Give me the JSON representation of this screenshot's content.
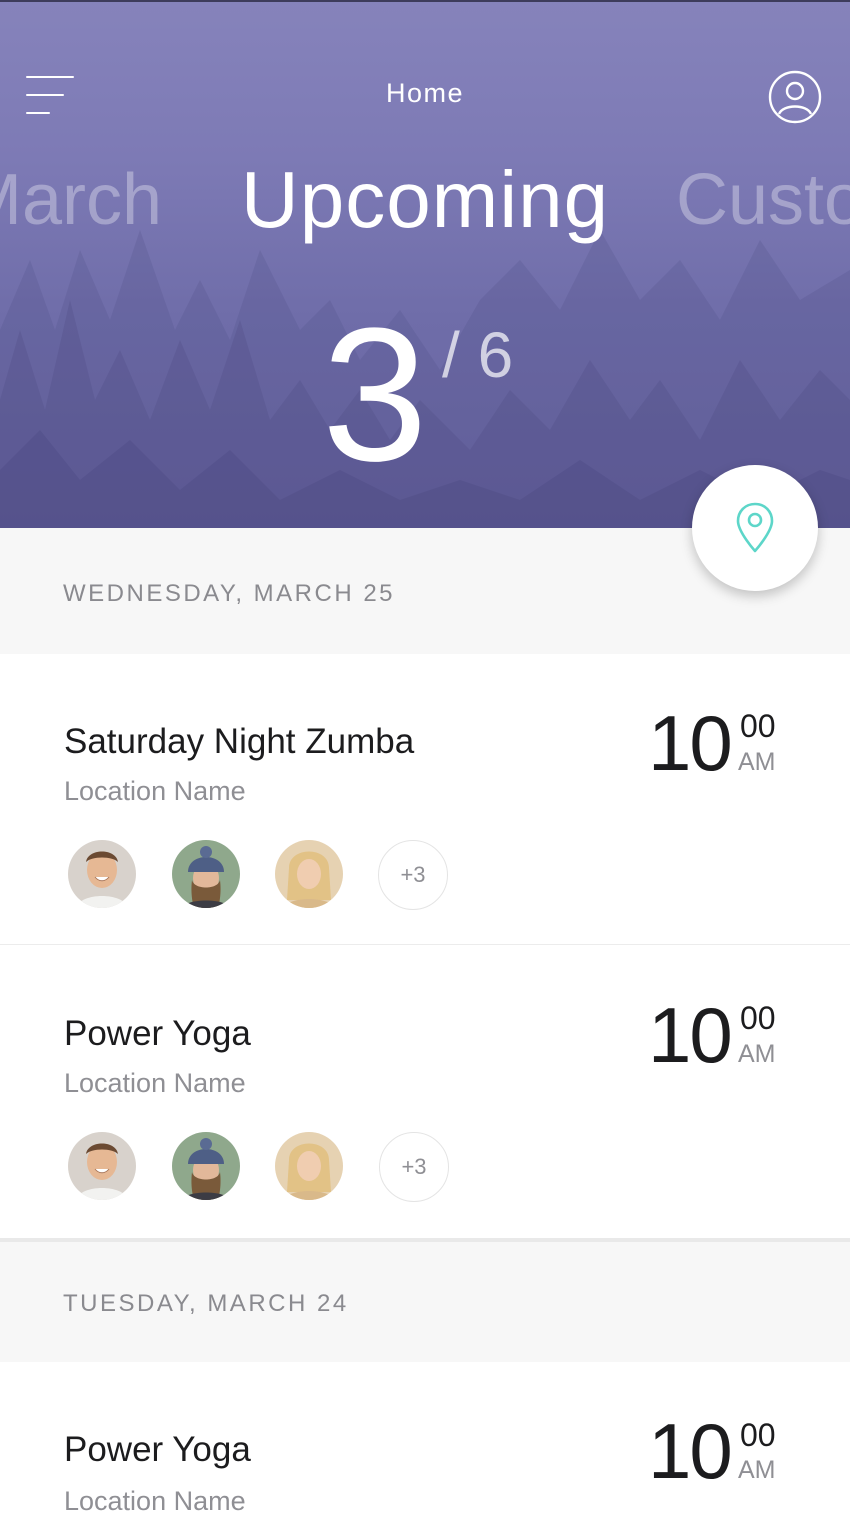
{
  "header": {
    "title": "Home",
    "tabs": [
      "March",
      "Upcoming",
      "Custom"
    ],
    "active_tab_index": 1,
    "counter": {
      "current": "3",
      "total": "/ 6"
    }
  },
  "colors": {
    "hero_purple": "#7d7ab5",
    "accent_teal": "#5dd6c9",
    "background_grey": "#f7f7f7"
  },
  "icons": {
    "menu": "hamburger-menu-icon",
    "profile": "user-profile-icon",
    "location": "map-pin-icon"
  },
  "days": [
    {
      "label": "WEDNESDAY, MARCH 25",
      "events": [
        {
          "name": "Saturday Night Zumba",
          "location": "Location Name",
          "time_hour": "10",
          "time_minute": "00",
          "time_period": "AM",
          "attendees": [
            "Smiling man",
            "Woman in blue beanie",
            "Blonde woman"
          ],
          "more_attendees": "+3"
        },
        {
          "name": "Power Yoga",
          "location": "Location Name",
          "time_hour": "10",
          "time_minute": "00",
          "time_period": "AM",
          "attendees": [
            "Smiling man",
            "Woman in blue beanie",
            "Blonde woman"
          ],
          "more_attendees": "+3"
        }
      ]
    },
    {
      "label": "TUESDAY, MARCH 24",
      "events": [
        {
          "name": "Power Yoga",
          "location": "Location Name",
          "time_hour": "10",
          "time_minute": "00",
          "time_period": "AM"
        }
      ]
    }
  ]
}
